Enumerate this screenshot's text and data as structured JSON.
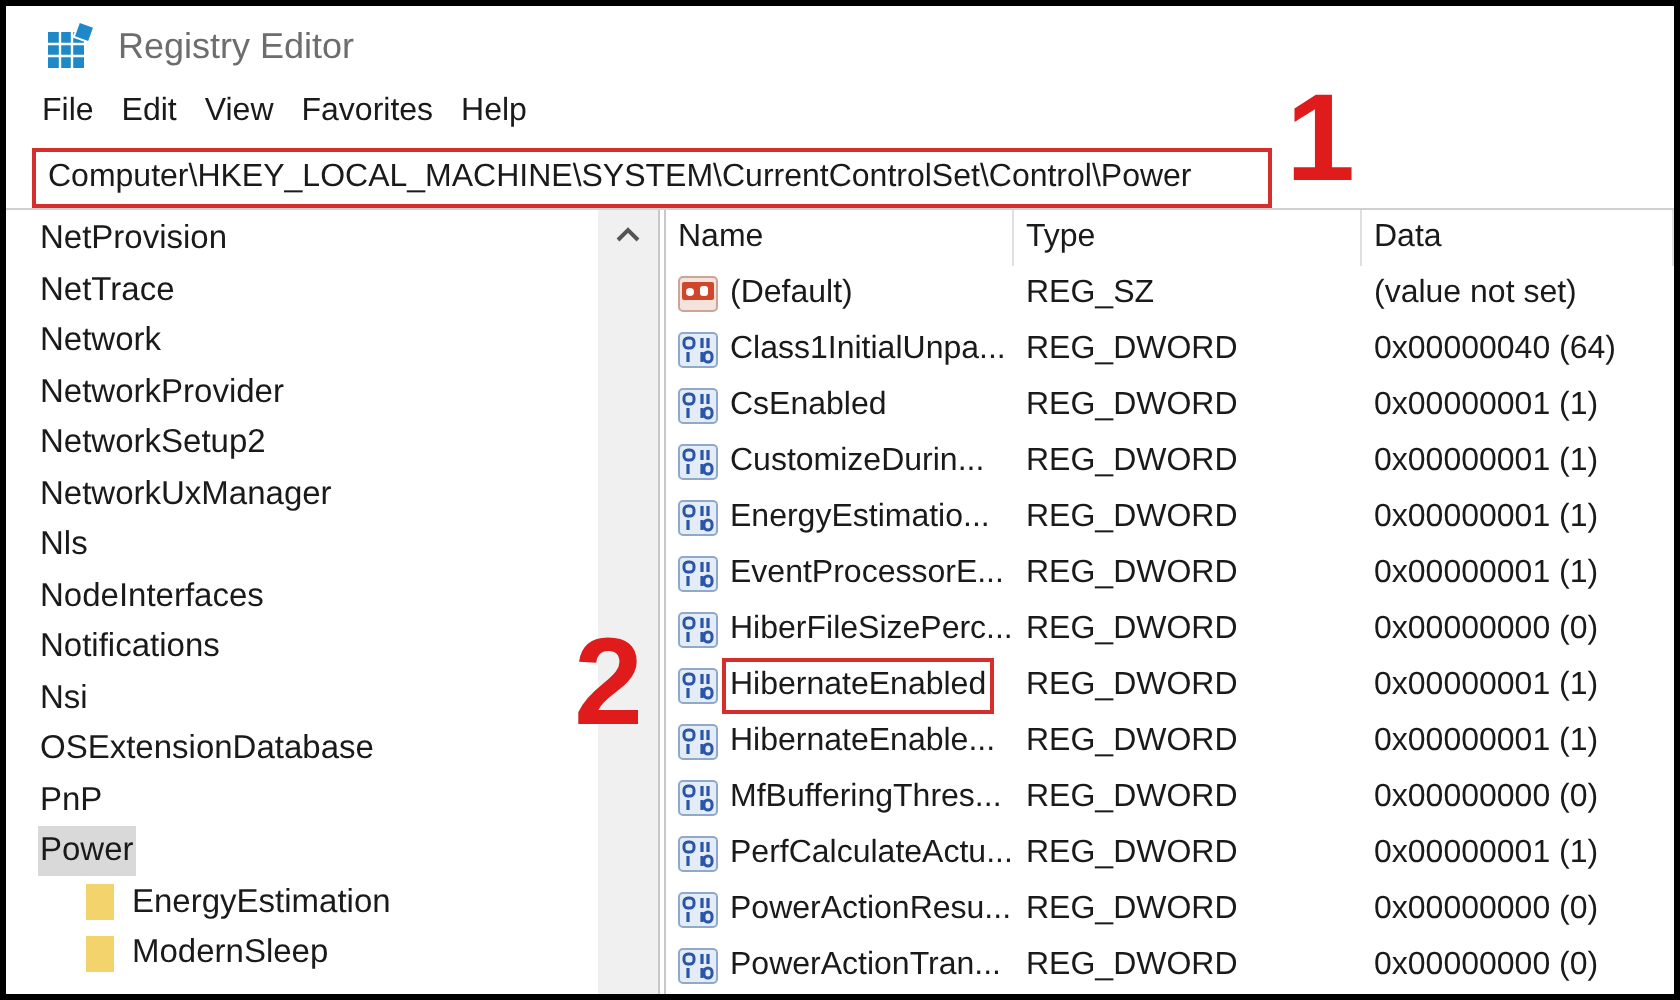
{
  "window": {
    "title": "Registry Editor"
  },
  "menu": [
    "File",
    "Edit",
    "View",
    "Favorites",
    "Help"
  ],
  "address_bar": {
    "value": "Computer\\HKEY_LOCAL_MACHINE\\SYSTEM\\CurrentControlSet\\Control\\Power",
    "highlighted": true
  },
  "tree": [
    {
      "label": "NetProvision",
      "selected": false
    },
    {
      "label": "NetTrace",
      "selected": false
    },
    {
      "label": "Network",
      "selected": false
    },
    {
      "label": "NetworkProvider",
      "selected": false
    },
    {
      "label": "NetworkSetup2",
      "selected": false
    },
    {
      "label": "NetworkUxManager",
      "selected": false
    },
    {
      "label": "Nls",
      "selected": false
    },
    {
      "label": "NodeInterfaces",
      "selected": false
    },
    {
      "label": "Notifications",
      "selected": false
    },
    {
      "label": "Nsi",
      "selected": false
    },
    {
      "label": "OSExtensionDatabase",
      "selected": false
    },
    {
      "label": "PnP",
      "selected": false
    },
    {
      "label": "Power",
      "selected": true,
      "children": [
        {
          "label": "EnergyEstimation",
          "selected": false
        },
        {
          "label": "ModernSleep",
          "selected": false
        }
      ]
    }
  ],
  "columns": [
    "Name",
    "Type",
    "Data"
  ],
  "values": [
    {
      "kind": "string",
      "name": "(Default)",
      "type": "REG_SZ",
      "data": "(value not set)",
      "highlighted": false
    },
    {
      "kind": "dword",
      "name": "Class1InitialUnpa...",
      "type": "REG_DWORD",
      "data": "0x00000040 (64)",
      "highlighted": false
    },
    {
      "kind": "dword",
      "name": "CsEnabled",
      "type": "REG_DWORD",
      "data": "0x00000001 (1)",
      "highlighted": false
    },
    {
      "kind": "dword",
      "name": "CustomizeDurin...",
      "type": "REG_DWORD",
      "data": "0x00000001 (1)",
      "highlighted": false
    },
    {
      "kind": "dword",
      "name": "EnergyEstimatio...",
      "type": "REG_DWORD",
      "data": "0x00000001 (1)",
      "highlighted": false
    },
    {
      "kind": "dword",
      "name": "EventProcessorE...",
      "type": "REG_DWORD",
      "data": "0x00000001 (1)",
      "highlighted": false
    },
    {
      "kind": "dword",
      "name": "HiberFileSizePerc...",
      "type": "REG_DWORD",
      "data": "0x00000000 (0)",
      "highlighted": false
    },
    {
      "kind": "dword",
      "name": "HibernateEnabled",
      "type": "REG_DWORD",
      "data": "0x00000001 (1)",
      "highlighted": true
    },
    {
      "kind": "dword",
      "name": "HibernateEnable...",
      "type": "REG_DWORD",
      "data": "0x00000001 (1)",
      "highlighted": false
    },
    {
      "kind": "dword",
      "name": "MfBufferingThres...",
      "type": "REG_DWORD",
      "data": "0x00000000 (0)",
      "highlighted": false
    },
    {
      "kind": "dword",
      "name": "PerfCalculateActu...",
      "type": "REG_DWORD",
      "data": "0x00000001 (1)",
      "highlighted": false
    },
    {
      "kind": "dword",
      "name": "PowerActionResu...",
      "type": "REG_DWORD",
      "data": "0x00000000 (0)",
      "highlighted": false
    },
    {
      "kind": "dword",
      "name": "PowerActionTran...",
      "type": "REG_DWORD",
      "data": "0x00000000 (0)",
      "highlighted": false
    }
  ],
  "annotations": [
    {
      "label": "1"
    },
    {
      "label": "2"
    }
  ]
}
